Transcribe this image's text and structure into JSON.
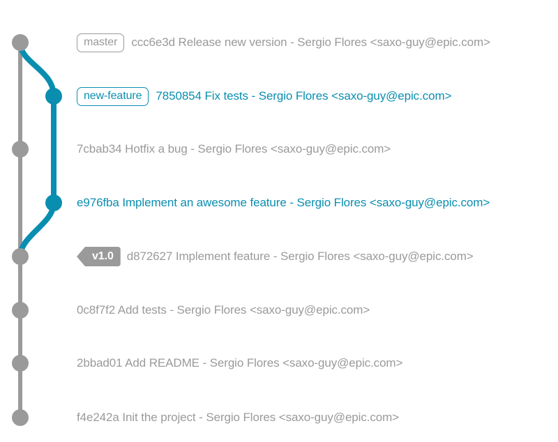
{
  "colors": {
    "master": "#9a9a9a",
    "feature": "#0a8eb0",
    "tag_background": "#9a9a9a",
    "tag_text": "#ffffff"
  },
  "commits": [
    {
      "branch_label": "master",
      "tag": "",
      "text": "ccc6e3d Release new version - Sergio Flores <saxo-guy@epic.com>",
      "lane": "master"
    },
    {
      "branch_label": "new-feature",
      "tag": "",
      "text": "7850854 Fix tests - Sergio Flores <saxo-guy@epic.com>",
      "lane": "feature"
    },
    {
      "branch_label": "",
      "tag": "",
      "text": "7cbab34 Hotfix a bug - Sergio Flores <saxo-guy@epic.com>",
      "lane": "master"
    },
    {
      "branch_label": "",
      "tag": "",
      "text": "e976fba Implement an awesome feature - Sergio Flores <saxo-guy@epic.com>",
      "lane": "feature"
    },
    {
      "branch_label": "",
      "tag": "v1.0",
      "text": "d872627 Implement feature - Sergio Flores <saxo-guy@epic.com>",
      "lane": "master"
    },
    {
      "branch_label": "",
      "tag": "",
      "text": "0c8f7f2 Add tests - Sergio Flores <saxo-guy@epic.com>",
      "lane": "master"
    },
    {
      "branch_label": "",
      "tag": "",
      "text": "2bbad01 Add README - Sergio Flores <saxo-guy@epic.com>",
      "lane": "master"
    },
    {
      "branch_label": "",
      "tag": "",
      "text": "f4e242a Init the project - Sergio Flores <saxo-guy@epic.com>",
      "lane": "master"
    }
  ]
}
